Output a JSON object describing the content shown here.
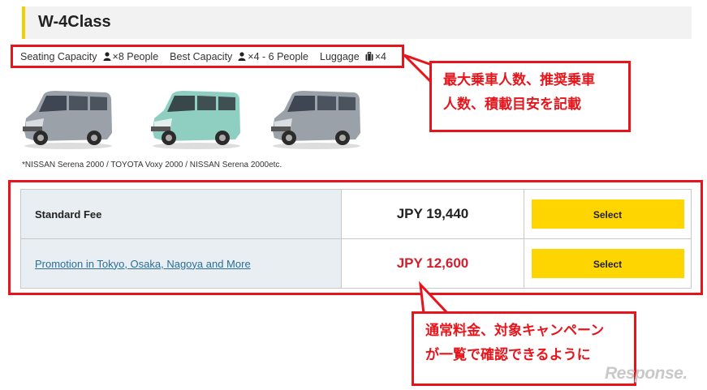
{
  "header": {
    "title": "W-4Class"
  },
  "capacity": {
    "seating_label": "Seating Capacity",
    "seating_value": "×8 People",
    "best_label": "Best Capacity",
    "best_value": "×4 - 6 People",
    "luggage_label": "Luggage",
    "luggage_value": "×4",
    "icons": {
      "person": "person-icon",
      "luggage": "luggage-icon"
    }
  },
  "cars": {
    "note": "*NISSAN Serena 2000 / TOYOTA Voxy 2000 / NISSAN Serena 2000etc."
  },
  "fees": {
    "rows": [
      {
        "label": "Standard Fee",
        "price": "JPY 19,440",
        "button": "Select"
      },
      {
        "label": "Promotion in Tokyo, Osaka, Nagoya and More",
        "price": "JPY 12,600",
        "button": "Select"
      }
    ]
  },
  "callouts": {
    "top": [
      "最大乗車人数、推奨乗車",
      "人数、積載目安を記載"
    ],
    "bottom": [
      "通常料金、対象キャンペーン",
      "が一覧で確認できるように"
    ]
  },
  "watermark": {
    "text": "Response."
  },
  "colors": {
    "accent_yellow": "#ffd500",
    "highlight_red": "#e8141b",
    "promo_price_red": "#d21f2d",
    "link_blue": "#2a6e99",
    "label_cell_bg": "#e8eef2"
  }
}
